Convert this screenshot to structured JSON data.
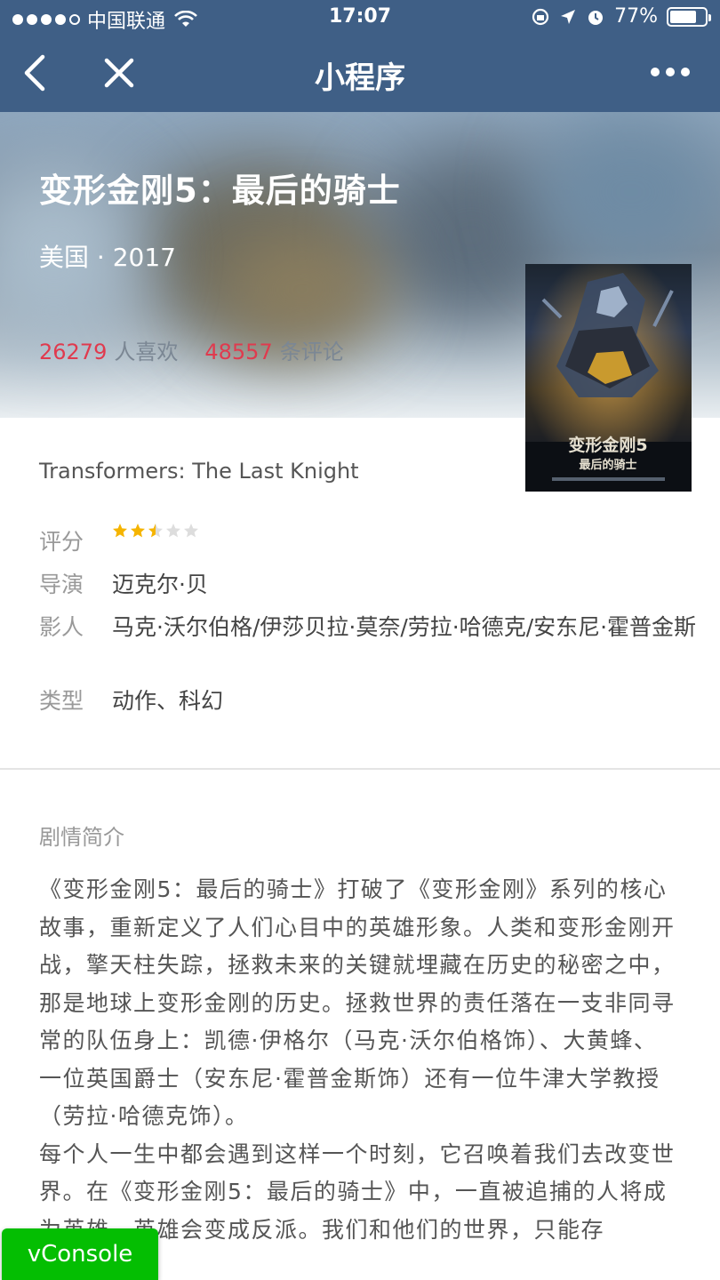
{
  "status_bar": {
    "carrier": "中国联通",
    "time": "17:07",
    "battery": "77%",
    "battery_level": 0.77
  },
  "nav": {
    "title": "小程序"
  },
  "movie": {
    "title": "变形金刚5：最后的骑士",
    "meta": "美国 · 2017",
    "likes_count": "26279",
    "likes_label": "人喜欢",
    "comments_count": "48557",
    "comments_label": "条评论",
    "original_title": "Transformers: The Last Knight",
    "poster": {
      "headline": "变形金刚5",
      "subline": "最后的骑士"
    }
  },
  "info": {
    "rating_label": "评分",
    "rating_stars": 2.5,
    "rating_max": 5,
    "director_label": "导演",
    "director": "迈克尔·贝",
    "cast_label": "影人",
    "cast": "马克·沃尔伯格/伊莎贝拉·莫奈/劳拉·哈德克/安东尼·霍普金斯",
    "genre_label": "类型",
    "genre": "动作、科幻"
  },
  "summary": {
    "title": "剧情简介",
    "p1": "《变形金刚5：最后的骑士》打破了《变形金刚》系列的核心故事，重新定义了人们心目中的英雄形象。人类和变形金刚开战，擎天柱失踪，拯救未来的关键就埋藏在历史的秘密之中，那是地球上变形金刚的历史。拯救世界的责任落在一支非同寻常的队伍身上：凯德·伊格尔（马克·沃尔伯格饰）、大黄蜂、一位英国爵士（安东尼·霍普金斯饰）还有一位牛津大学教授（劳拉·哈德克饰）。",
    "p2": "每个人一生中都会遇到这样一个时刻，它召唤着我们去改变世界。在《变形金刚5：最后的骑士》中，一直被追捕的人将成为英雄，英雄会变成反派。我们和他们的世界，只能存"
  },
  "vconsole_label": "vConsole",
  "colors": {
    "nav_bg": "#3f5f86",
    "accent_red": "#e03a4e",
    "star_gold": "#f5b400",
    "star_gray": "#dddddd",
    "vconsole_green": "#04be02"
  }
}
